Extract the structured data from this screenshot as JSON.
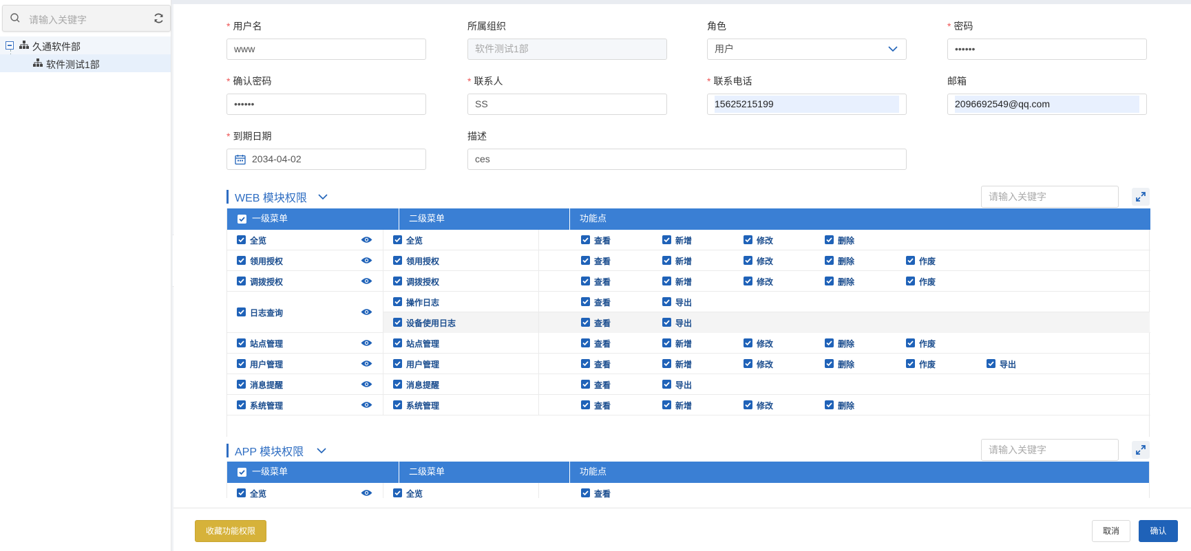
{
  "sidebar": {
    "search_placeholder": "请输入关键字",
    "tree": [
      {
        "label": "久通软件部"
      },
      {
        "label": "软件测试1部"
      }
    ]
  },
  "form": {
    "username": {
      "label": "用户名",
      "required": true,
      "value": "www"
    },
    "org": {
      "label": "所属组织",
      "value": "软件测试1部"
    },
    "role": {
      "label": "角色",
      "value": "用户"
    },
    "password": {
      "label": "密码",
      "required": true,
      "value": "••••••"
    },
    "confirm_password": {
      "label": "确认密码",
      "required": true,
      "value": "••••••"
    },
    "contact": {
      "label": "联系人",
      "required": true,
      "value": "SS"
    },
    "phone": {
      "label": "联系电话",
      "required": true,
      "value": "15625215199"
    },
    "email": {
      "label": "邮箱",
      "value": "2096692549@qq.com"
    },
    "expire": {
      "label": "到期日期",
      "required": true,
      "value": "2034-04-02"
    },
    "desc": {
      "label": "描述",
      "value": "ces"
    },
    "required_mark": "*"
  },
  "web": {
    "title": "WEB 模块权限",
    "search_placeholder": "请输入关键字",
    "headers": {
      "c1": "一级菜单",
      "c2": "二级菜单",
      "c3": "功能点"
    },
    "rows": [
      {
        "l1": "全览",
        "l2": "全览",
        "funcs": [
          "查看",
          "新增",
          "修改",
          "删除"
        ]
      },
      {
        "l1": "领用授权",
        "l2": "领用授权",
        "funcs": [
          "查看",
          "新增",
          "修改",
          "删除",
          "作废"
        ]
      },
      {
        "l1": "调拨授权",
        "l2": "调拨授权",
        "funcs": [
          "查看",
          "新增",
          "修改",
          "删除",
          "作废"
        ]
      },
      {
        "l1": "日志查询",
        "subs": [
          {
            "l2": "操作日志",
            "funcs": [
              "查看",
              "导出"
            ]
          },
          {
            "l2": "设备使用日志",
            "funcs": [
              "查看",
              "导出"
            ]
          }
        ]
      },
      {
        "l1": "站点管理",
        "l2": "站点管理",
        "funcs": [
          "查看",
          "新增",
          "修改",
          "删除",
          "作废"
        ]
      },
      {
        "l1": "用户管理",
        "l2": "用户管理",
        "funcs": [
          "查看",
          "新增",
          "修改",
          "删除",
          "作废",
          "导出"
        ]
      },
      {
        "l1": "消息提醒",
        "l2": "消息提醒",
        "funcs": [
          "查看",
          "导出"
        ]
      },
      {
        "l1": "系统管理",
        "l2": "系统管理",
        "funcs": [
          "查看",
          "新增",
          "修改",
          "删除"
        ]
      }
    ]
  },
  "app": {
    "title": "APP 模块权限",
    "search_placeholder": "请输入关键字",
    "headers": {
      "c1": "一级菜单",
      "c2": "二级菜单",
      "c3": "功能点"
    },
    "rows": [
      {
        "l1": "全览",
        "l2": "全览",
        "funcs": [
          "查看"
        ]
      }
    ]
  },
  "footer": {
    "collect": "收藏功能权限",
    "cancel": "取消",
    "confirm": "确认"
  },
  "colors": {
    "primary": "#1f62b8",
    "header": "#3a7fd4",
    "gold": "#d6b23a",
    "required": "#e55555"
  }
}
